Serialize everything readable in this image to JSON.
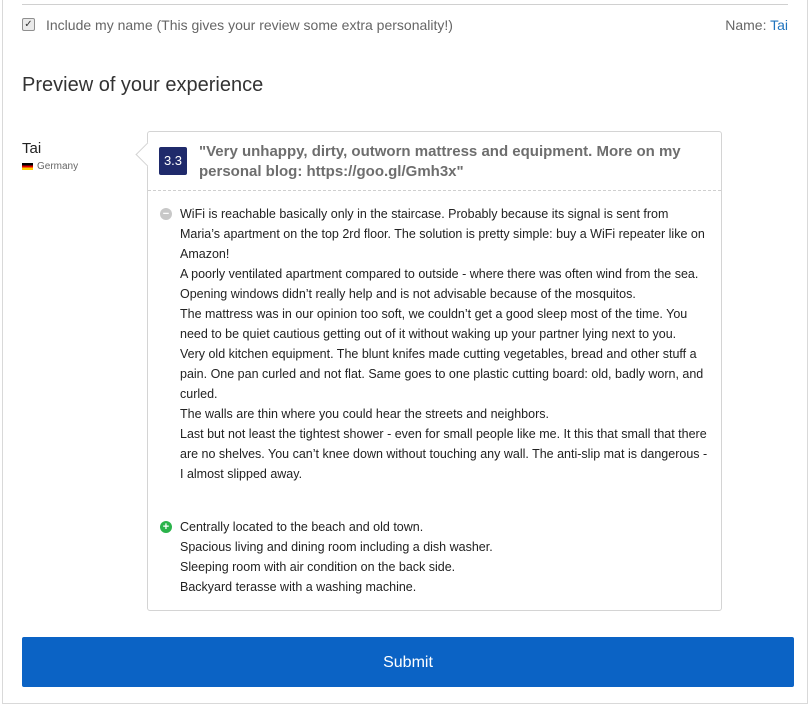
{
  "include_name": {
    "checked": true,
    "label": "Include my name (This gives your review some extra personality!)",
    "name_label": "Name:",
    "name_value": "Tai"
  },
  "preview": {
    "heading": "Preview of your experience",
    "author": {
      "name": "Tai",
      "country": "Germany",
      "flag_icon": "germany-flag-icon"
    },
    "score": "3.3",
    "title": "\"Very unhappy, dirty, outworn mattress and equipment. More on my personal blog: https://goo.gl/Gmh3x\"",
    "negatives": [
      "WiFi is reachable basically only in the staircase. Probably because its signal is sent from Maria’s apartment on the top 2rd floor. The solution is pretty simple: buy a WiFi repeater like on Amazon!",
      "A poorly ventilated apartment compared to outside - where there was often wind from the sea. Opening windows didn’t really help and is not advisable because of the mosquitos.",
      "The mattress was in our opinion too soft, we couldn’t get a good sleep most of the time. You need to be quiet cautious getting out of it without waking up your partner lying next to you.",
      "Very old kitchen equipment. The blunt knifes made cutting vegetables, bread and other stuff a pain. One pan curled and not flat. Same goes to one plastic cutting board: old, badly worn, and curled.",
      "The walls are thin where you could hear the streets and neighbors.",
      "Last but not least the tightest shower - even for small people like me. It this that small that there are no shelves. You can’t knee down without touching any wall. The anti-slip mat is dangerous - I almost slipped away."
    ],
    "positives": [
      "Centrally located to the beach and old town.",
      "Spacious living and dining room including a dish washer.",
      "Sleeping room with air condition on the back side.",
      "Backyard terasse with a washing machine."
    ],
    "negative_icon": "minus-circle-icon",
    "positive_icon": "plus-circle-icon"
  },
  "submit_label": "Submit",
  "colors": {
    "score_bg": "#1f2a6b",
    "submit_bg": "#0b63c5",
    "link": "#1e73be",
    "positive": "#2bb34b",
    "negative": "#c8c8c8"
  }
}
